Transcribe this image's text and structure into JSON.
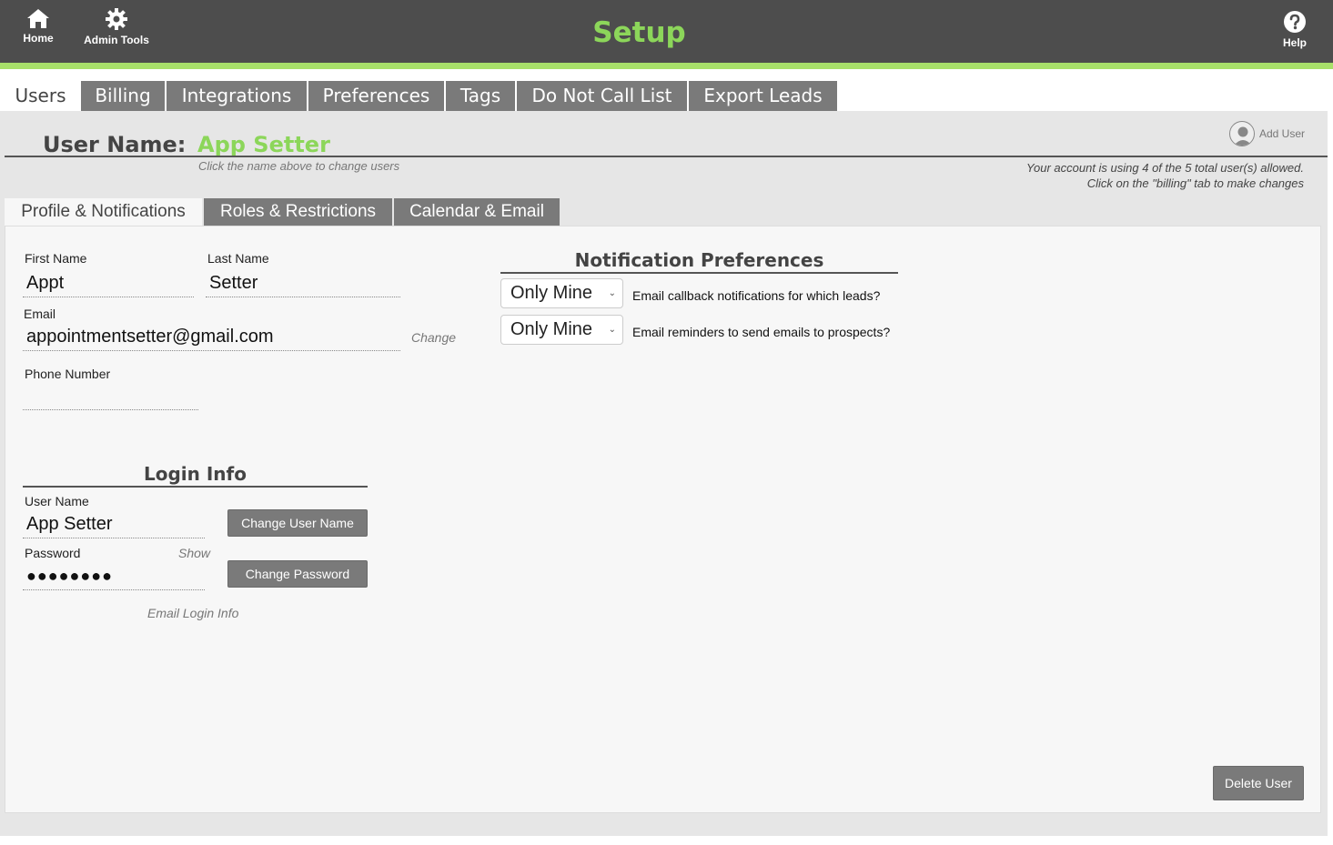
{
  "topbar": {
    "home_label": "Home",
    "admin_label": "Admin Tools",
    "title": "Setup",
    "help_label": "Help"
  },
  "main_tabs": {
    "users": "Users",
    "billing": "Billing",
    "integrations": "Integrations",
    "preferences": "Preferences",
    "tags": "Tags",
    "dnc": "Do Not Call List",
    "export": "Export Leads"
  },
  "user_header": {
    "label": "User Name:",
    "value": "App Setter",
    "hint": "Click the name above to change users",
    "add_user": "Add User",
    "account_line1": "Your account is using 4 of the 5 total user(s) allowed.",
    "account_line2": "Click on the \"billing\" tab to make changes"
  },
  "sub_tabs": {
    "profile": "Profile & Notifications",
    "roles": "Roles & Restrictions",
    "calendar": "Calendar & Email"
  },
  "profile": {
    "first_name_label": "First Name",
    "first_name": "Appt",
    "last_name_label": "Last Name",
    "last_name": "Setter",
    "email_label": "Email",
    "email": "appointmentsetter@gmail.com",
    "change_link": "Change",
    "phone_label": "Phone Number",
    "phone": ""
  },
  "login": {
    "title": "Login Info",
    "username_label": "User Name",
    "username": "App Setter",
    "change_username_btn": "Change User Name",
    "password_label": "Password",
    "show_link": "Show",
    "password": "●●●●●●●●",
    "change_password_btn": "Change Password",
    "email_login_link": "Email Login Info"
  },
  "notifications": {
    "title": "Notification Preferences",
    "callback_value": "Only Mine",
    "callback_text": "Email callback notifications for which leads?",
    "reminder_value": "Only Mine",
    "reminder_text": "Email reminders to send emails to prospects?"
  },
  "delete_user_btn": "Delete User",
  "colors": {
    "brand_green": "#8cd65a",
    "topbar": "#4d4d4d",
    "tab_gray": "#7a7a7a"
  }
}
